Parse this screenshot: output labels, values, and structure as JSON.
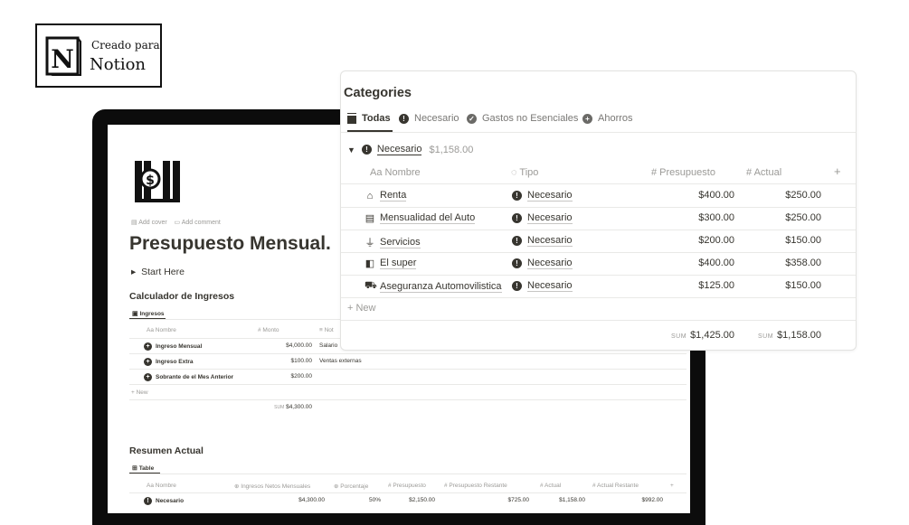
{
  "badge": {
    "small": "Creado para",
    "big": "Notion",
    "logo_icon": "notion-logo-icon"
  },
  "page": {
    "meta": {
      "add_cover": "Add cover",
      "add_comment": "Add comment"
    },
    "title": "Presupuesto Mensual.",
    "toggle": "Start Here",
    "ingresos": {
      "heading": "Calculador de Ingresos",
      "tab": "Ingresos",
      "columns": [
        "Aa Nombre",
        "# Monto",
        "≡ Not"
      ],
      "rows": [
        {
          "name": "Ingreso Mensual",
          "amount": "$4,000.00",
          "note": "Salario"
        },
        {
          "name": "Ingreso Extra",
          "amount": "$100.00",
          "note": "Ventas externas"
        },
        {
          "name": "Sobrante de el Mes Anterior",
          "amount": "$200.00",
          "note": ""
        }
      ],
      "new": "+ New",
      "sum_label": "SUM",
      "sum_value": "$4,300.00"
    },
    "resumen": {
      "heading": "Resumen Actual",
      "tab": "Table",
      "columns": [
        "Aa Nombre",
        "Ingresos Netos Mensuales",
        "Porcentaje",
        "# Presupuesto",
        "# Presupuesto Restante",
        "# Actual",
        "# Actual Restante",
        "+"
      ],
      "rows": [
        {
          "name": "Necesario",
          "ingresos": "$4,300.00",
          "porcentaje": "50%",
          "presupuesto": "$2,150.00",
          "restante": "$725.00",
          "actual": "$1,158.00",
          "actual_restante": "$992.00"
        }
      ]
    }
  },
  "categories": {
    "title": "Categories",
    "tabs": [
      {
        "label": "Todas",
        "icon": "table-icon"
      },
      {
        "label": "Necesario",
        "icon": "alert-circle-icon"
      },
      {
        "label": "Gastos no Esenciales",
        "icon": "check-circle-icon"
      },
      {
        "label": "Ahorros",
        "icon": "plus-circle-icon"
      }
    ],
    "group": {
      "name": "Necesario",
      "sum": "$1,158.00"
    },
    "columns": {
      "name": "Aa Nombre",
      "tipo": "Tipo",
      "presupuesto": "# Presupuesto",
      "actual": "# Actual",
      "add": "+"
    },
    "rows": [
      {
        "icon": "home-icon",
        "name": "Renta",
        "tipo": "Necesario",
        "presupuesto": "$400.00",
        "actual": "$250.00"
      },
      {
        "icon": "car-note-icon",
        "name": "Mensualidad del Auto",
        "tipo": "Necesario",
        "presupuesto": "$300.00",
        "actual": "$250.00"
      },
      {
        "icon": "plug-icon",
        "name": "Servicios",
        "tipo": "Necesario",
        "presupuesto": "$200.00",
        "actual": "$150.00"
      },
      {
        "icon": "grocery-icon",
        "name": "El super",
        "tipo": "Necesario",
        "presupuesto": "$400.00",
        "actual": "$358.00"
      },
      {
        "icon": "car-icon",
        "name": "Aseguranza Automovilistica",
        "tipo": "Necesario",
        "presupuesto": "$125.00",
        "actual": "$150.00"
      }
    ],
    "new": "+ New",
    "sum_label": "SUM",
    "sum_presupuesto": "$1,425.00",
    "sum_actual": "$1,158.00"
  }
}
